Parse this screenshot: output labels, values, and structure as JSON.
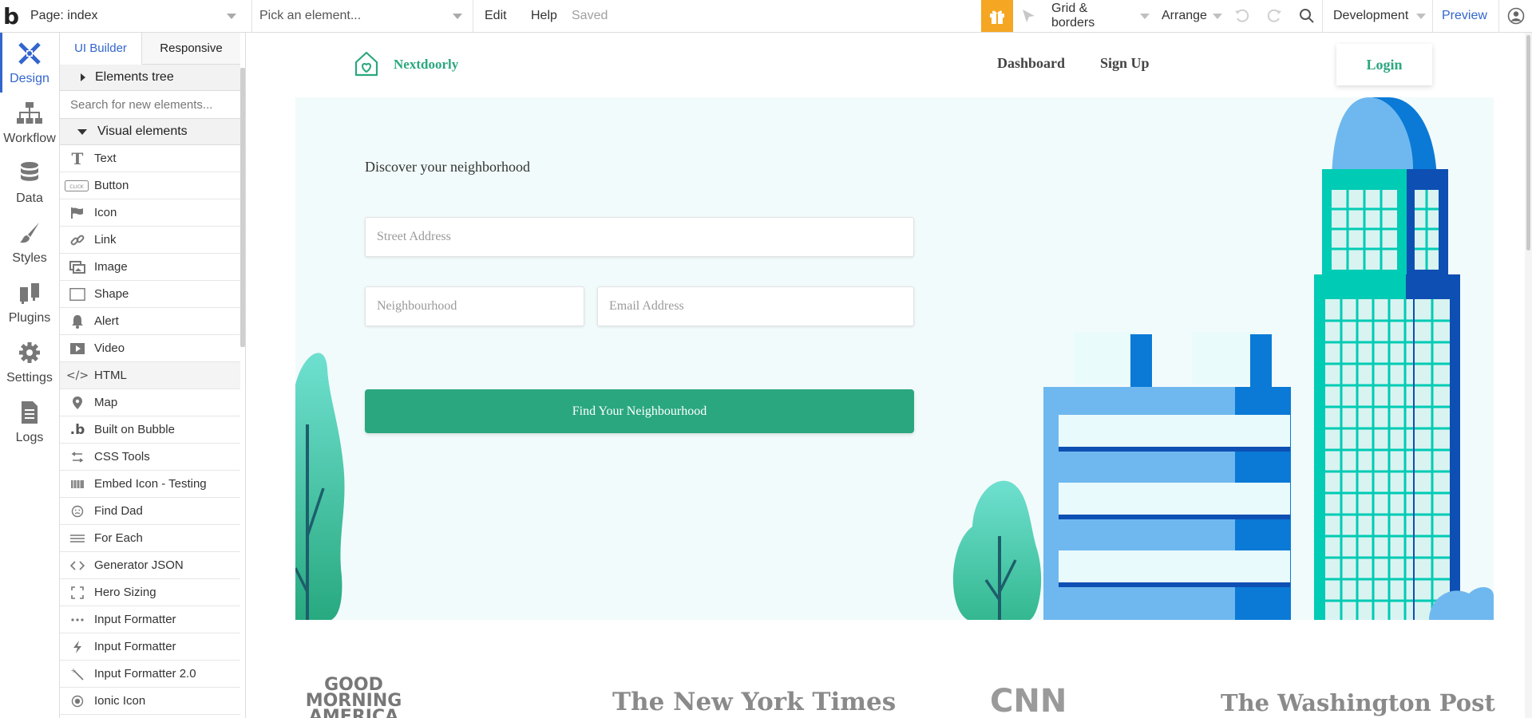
{
  "topbar": {
    "logo": "b",
    "page_label": "Page: index",
    "element_picker_placeholder": "Pick an element...",
    "edit": "Edit",
    "help": "Help",
    "saved": "Saved",
    "grid_borders": "Grid & borders",
    "arrange": "Arrange",
    "environment": "Development",
    "preview": "Preview",
    "accent_color": "#f5a623"
  },
  "rail": {
    "items": [
      {
        "label": "Design",
        "icon": "design-icon"
      },
      {
        "label": "Workflow",
        "icon": "workflow-icon"
      },
      {
        "label": "Data",
        "icon": "data-icon"
      },
      {
        "label": "Styles",
        "icon": "styles-icon"
      },
      {
        "label": "Plugins",
        "icon": "plugins-icon"
      },
      {
        "label": "Settings",
        "icon": "settings-icon"
      },
      {
        "label": "Logs",
        "icon": "logs-icon"
      }
    ],
    "active_color": "#3366cc"
  },
  "panel": {
    "tabs": [
      "UI Builder",
      "Responsive"
    ],
    "elements_tree": "Elements tree",
    "search_placeholder": "Search for new elements...",
    "visual_elements": "Visual elements",
    "elements": [
      {
        "label": "Text",
        "icon": "text-icon"
      },
      {
        "label": "Button",
        "icon": "button-icon"
      },
      {
        "label": "Icon",
        "icon": "flag-icon"
      },
      {
        "label": "Link",
        "icon": "link-icon"
      },
      {
        "label": "Image",
        "icon": "image-icon"
      },
      {
        "label": "Shape",
        "icon": "shape-icon"
      },
      {
        "label": "Alert",
        "icon": "bell-icon"
      },
      {
        "label": "Video",
        "icon": "video-icon"
      },
      {
        "label": "HTML",
        "icon": "code-icon"
      },
      {
        "label": "Map",
        "icon": "map-pin-icon"
      },
      {
        "label": "Built on Bubble",
        "icon": "bubble-icon"
      },
      {
        "label": "CSS Tools",
        "icon": "css-tools-icon"
      },
      {
        "label": "Embed Icon - Testing",
        "icon": "embed-icon"
      },
      {
        "label": "Find Dad",
        "icon": "face-icon"
      },
      {
        "label": "For Each",
        "icon": "lines-icon"
      },
      {
        "label": "Generator JSON",
        "icon": "brackets-icon"
      },
      {
        "label": "Hero Sizing",
        "icon": "expand-icon"
      },
      {
        "label": "Input Formatter",
        "icon": "dots-icon"
      },
      {
        "label": "Input Formatter",
        "icon": "bolt-icon"
      },
      {
        "label": "Input Formatter 2.0",
        "icon": "wand-icon"
      },
      {
        "label": "Ionic Icon",
        "icon": "target-icon"
      }
    ]
  },
  "site": {
    "brand": "Nextdoorly",
    "brand_color": "#2aa77f",
    "nav": [
      "Dashboard",
      "Sign Up",
      "Login"
    ],
    "tagline": "Discover your neighborhood",
    "street_placeholder": "Street Address",
    "neighbourhood_placeholder": "Neighbourhood",
    "email_placeholder": "Email Address",
    "cta": "Find Your Neighbourhood",
    "press": [
      "GOOD MORNING AMERICA",
      "The New York Times",
      "CNN",
      "The Washington Post"
    ]
  }
}
